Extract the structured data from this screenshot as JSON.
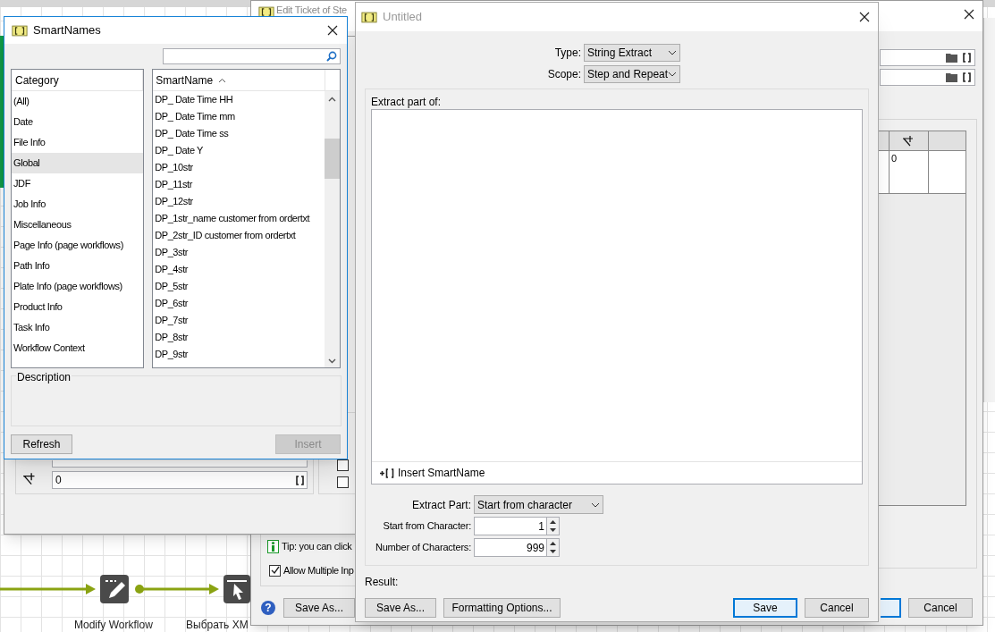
{
  "workflow": {
    "steps": [
      {
        "label": "Modify Workflow",
        "kind": "edit"
      },
      {
        "label": "Выбрать XM",
        "kind": "select"
      }
    ]
  },
  "edit_ticket": {
    "title": "Edit Ticket of Ste",
    "table_cell": "0",
    "tip": "Tip: you can click",
    "allow_multiple": {
      "label": "Allow Multiple Inp",
      "checked": true
    },
    "help": "?",
    "buttons": [
      {
        "label": "Save As..."
      },
      {
        "label": "Cancel"
      }
    ]
  },
  "parameter_panel": {
    "value": "0",
    "checkboxes": [
      {
        "checked": false
      },
      {
        "checked": false
      }
    ]
  },
  "smartnames": {
    "title": "SmartNames",
    "category_header": "Category",
    "categories": [
      {
        "label": "(All)",
        "selected": false
      },
      {
        "label": "Date",
        "selected": false
      },
      {
        "label": "File Info",
        "selected": false
      },
      {
        "label": "Global",
        "selected": true
      },
      {
        "label": "JDF",
        "selected": false
      },
      {
        "label": "Job Info",
        "selected": false
      },
      {
        "label": "Miscellaneous",
        "selected": false
      },
      {
        "label": "Page Info (page workflows)",
        "selected": false
      },
      {
        "label": "Path Info",
        "selected": false
      },
      {
        "label": "Plate Info (page workflows)",
        "selected": false
      },
      {
        "label": "Product Info",
        "selected": false
      },
      {
        "label": "Task Info",
        "selected": false
      },
      {
        "label": "Workflow Context",
        "selected": false
      }
    ],
    "name_header": "SmartName",
    "names": [
      "DP_ Date Time HH",
      "DP_ Date Time mm",
      "DP_ Date Time ss",
      "DP_ Date Y",
      "DP_10str",
      "DP_11str",
      "DP_12str",
      "DP_1str_name customer from ordertxt",
      "DP_2str_ID customer from ordertxt",
      "DP_3str",
      "DP_4str",
      "DP_5str",
      "DP_6str",
      "DP_7str",
      "DP_8str",
      "DP_9str"
    ],
    "description_label": "Description",
    "buttons": [
      {
        "label": "Refresh",
        "disabled": false
      },
      {
        "label": "Insert",
        "disabled": true
      }
    ]
  },
  "untitled": {
    "title": "Untitled",
    "type": {
      "label": "Type:",
      "value": "String Extract"
    },
    "scope": {
      "label": "Scope:",
      "value": "Step and Repeat"
    },
    "extract_label": "Extract part of:",
    "insert_link": "Insert SmartName",
    "extract_part": {
      "label": "Extract Part:",
      "value": "Start from character"
    },
    "start": {
      "label": "Start from Character:",
      "value": "1"
    },
    "count": {
      "label": "Number of Characters:",
      "value": "999"
    },
    "result_label": "Result:",
    "buttons": [
      {
        "label": "Save As...",
        "default": false
      },
      {
        "label": "Formatting Options...",
        "default": false
      },
      {
        "label": "Save",
        "default": true
      },
      {
        "label": "Cancel",
        "default": false
      }
    ]
  }
}
